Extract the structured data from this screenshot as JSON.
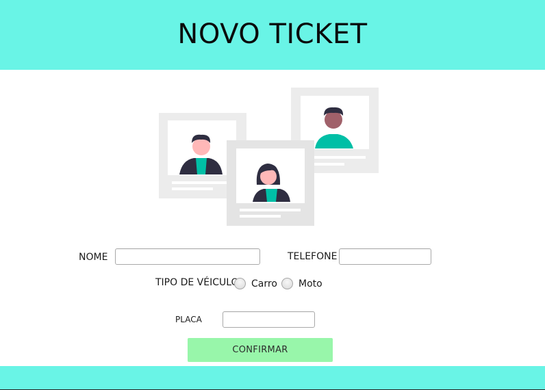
{
  "header": {
    "title": "NOVO TICKET"
  },
  "form": {
    "nome_label": "NOME",
    "nome_value": "",
    "telefone_label": "TELEFONE",
    "telefone_value": "",
    "tipo_label": "TIPO DE VÉICULO",
    "radio_carro_label": "Carro",
    "radio_moto_label": "Moto",
    "placa_label": "PLACA",
    "placa_value": ""
  },
  "actions": {
    "confirm_label": "CONFIRMAR"
  },
  "colors": {
    "header_bg": "#69f4e6",
    "button_bg": "#98f6aa",
    "accent_teal": "#00bfa6"
  },
  "icons": [
    "profile-cards-illustration"
  ]
}
